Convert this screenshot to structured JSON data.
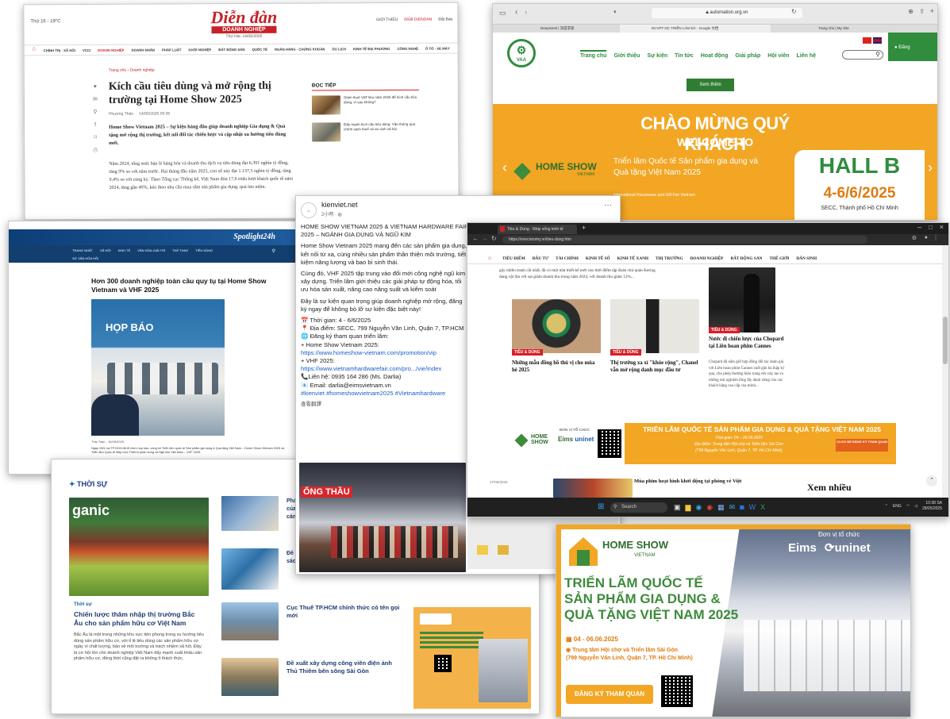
{
  "colors": {
    "accent": "#d7261e",
    "orange": "#f2a623",
    "green": "#3d8b3b",
    "blue": "#1e5ba8",
    "dark": "#1e1e1e"
  },
  "c1": {
    "date": "Thứ 16 - 19°C",
    "logo_top": "Diễn đàn",
    "logo_bottom": "DOANH NGHIỆP",
    "logo_date": "Thứ Hai, 16/05/2025",
    "top_right": [
      "GIỚI THIỆU",
      "0938 DIENDAN",
      "Đặt Báo"
    ],
    "nav": [
      "CHÍNH TRỊ - XÃ HỘI",
      "VCCI",
      "DOANH NGHIỆP",
      "DOANH NHÂN",
      "PHÁP LUẬT",
      "KHỞI NGHIỆP",
      "BẤT ĐỘNG SẢN",
      "QUỐC TẾ",
      "NGÂN HÀNG - CHỨNG KHOÁN",
      "DU LỊCH",
      "KINH TẾ ĐỊA PHƯƠNG",
      "CÔNG NGHỆ",
      "Ô TÔ - XE MÁY"
    ],
    "breadcrumb": "Trang chủ  ›  Doanh nghiệp",
    "title": "Kích cầu tiêu dùng và mở rộng thị trường tại Home Show 2025",
    "author": "Phương Thảo",
    "time": "14/05/2025 09:36",
    "lead": "Home Show Vietnam 2025 – Sự kiện hàng đầu giúp doanh nghiệp Gia dụng & Quà tặng mở rộng thị trường, kết nối đối tác chiến lược và cập nhật xu hướng tiêu dùng mới.",
    "body1": "Năm 2024, tổng mức bán lẻ hàng hóa và doanh thu dịch vụ tiêu dùng đạt 6.391 nghìn tỷ đồng, tăng 9% so với năm trước. Hai tháng đầu năm 2025, con số này đạt 1.137,5 nghìn tỷ đồng, tăng 9,4% so với cùng kỳ. Theo Tổng cục Thống kê, Việt Nam đón 17,6 triệu lượt khách quốc tế năm 2024, tăng gần 40%, kéo theo nhu cầu mua sắm sản phẩm gia dụng, quà lưu niệm.",
    "sidebar_title": "ĐỌC TIẾP",
    "sidebar_items": [
      "Giảm thuế VAT liệu năm 2025 để kích cầu tiêu dùng, vì sao không?",
      "Đẩy mạnh kích cầu tiêu dùng: Vận thông qua chính sách thuế và an sinh xã hội"
    ]
  },
  "c2": {
    "tabs": [
      "DeepSeek | 深度求索",
      "DCVPT NC TRIỂN LÃM ĐÃ - Google 文档",
      "Trang chủ | My Site"
    ],
    "url": "automation.org.vn",
    "vaa": "VAA",
    "nav": [
      "Trang chủ",
      "Giới thiệu",
      "Sự kiện",
      "Tin tức",
      "Hoạt động",
      "Giải pháp",
      "Hội viên",
      "Liên hệ"
    ],
    "more_btn": "Xem thêm",
    "welcome_vi": "CHÀO MỪNG QUÝ KHÁCH",
    "welcome_en": "WELCOME TO",
    "brand": "HOME SHOW",
    "brand_sub": "VIETNAM",
    "expo_vi": "Triển lãm Quốc tế Sản phẩm gia dụng và Quà tặng Việt Nam 2025",
    "expo_en": "International Houseware and Gift Fair Vietnam",
    "hall": "HALL B",
    "dates": "4-6/6/2025",
    "venue": "SECC, Thành phố Hồ Chí Minh",
    "login": "Đăng"
  },
  "c3": {
    "site": "Spotlight24h",
    "nav": [
      "TRANG NHẤT",
      "XÃ HỘI",
      "KINH TẾ",
      "VĂN HÓA-GIẢI TRÍ",
      "THỂ THAO",
      "TIÊU DÙNG"
    ],
    "nav2": "SỨ VĂN HÓA HỘI",
    "title": "Hơn 300 doanh nghiệp toàn cầu quy tụ tại Home Show Vietnam và VHF 2025",
    "photo_text": "HỌP BÁO",
    "author": "Thái Toàn",
    "date": "15/05/2025",
    "caption": "Ngày 15/5, tại TP.HCM đã tổ chức họp báo, công bố Triển lãm quốc tế Sản phẩm gia dụng & Quà tặng Việt Nam – Home Show Vietnam 2025 và Triển lãm Quốc tế Máy móc Thiết bị phần cứng và Ngũ kim Việt Nam – VHF 2025."
  },
  "c4": {
    "account": "kienviet.net",
    "meta": "2小時 · ",
    "para1": "HOME SHOW VIETNAM 2025 & VIETNAM HARDWARE FAIR 2025 – NGÀNH GIA DỤNG VÀ NGŨ KIM",
    "para2": "Home Show Vietnam 2025 mang đến các sản phẩm gia dụng, kết nối từ xa, cùng nhiều sản phẩm thân thiện môi trường, tiết kiệm năng lượng và bao bì sinh thái.",
    "para3": "Cùng đó, VHF 2025 tập trung vào đổi mới công nghệ ngũ kim xây dựng. Triển lãm giới thiệu các giải pháp tự động hóa, tối ưu hóa sản xuất, nâng cao năng suất và kiểm soát",
    "para4": "Đây là sự kiện quan trọng giúp doanh nghiệp mở rộng, đăng ký ngay để không bỏ lỡ sự kiện đặc biệt này!",
    "time": "📅 Thời gian: 4 - 6/6/2025",
    "place": "📍 Địa điểm: SECC, 799 Nguyễn Văn Linh, Quận 7, TP.HCM",
    "reg": "🌐 Đăng ký tham quan triển lãm:",
    "hs": "+ Home Show Vietnam 2025:",
    "link1": "https://www.homeshow-vietnam.com/promotion/vip",
    "vhf": "+ VHF 2025:",
    "link2": "https://www.vietnamhardwarefair.com/pro.../vie/index",
    "phone": "📞Liên hệ: 0935 164 286 (Ms. Darlia)",
    "email": "📧 Email: darlia@eimsvietnam.vn",
    "hashtags": "#kienviet #homeshowvietnam2025 #Vietnamhardware",
    "translate": "查看翻譯",
    "banner": "ỐNG THẦU"
  },
  "c5": {
    "section": "THỜI SỰ",
    "tag": "Thời sự",
    "main_title": "Chiến lược thâm nhập thị trường Bắc Âu cho sản phẩm hữu cơ Việt Nam",
    "main_desc": "Bắc Âu là một trong những khu vực tiên phong trong xu hướng tiêu dùng sản phẩm hữu cơ, với tỉ lệ tiêu dùng các sản phẩm hữu cơ ngày vì chất lượng, bảo vệ môi trường và trách nhiệm xã hội. Đây là cơ hội lớn cho doanh nghiệp Việt Nam đẩy mạnh xuất khẩu sản phẩm hữu cơ, đồng thời cũng đặt ra không ít thách thức.",
    "items": [
      "Phá của cán",
      "Đề sách",
      "Cục Thuế TP.HCM chính thức có tên gọi mới",
      "Đề xuất xây dựng công viên điện ảnh Thủ Thiêm bên sông Sài Gòn"
    ],
    "shelf_text": "ganic"
  },
  "c6": {
    "tab": "Tiêu & Dùng - Nhịp sống kinh tế",
    "url": "https://vneconomy.vn/tieu-dung.htm",
    "nav": [
      "TIÊU ĐIỂM",
      "ĐẦU TƯ",
      "TÀI CHÍNH",
      "KINH TẾ SỐ",
      "KINH TẾ XANH",
      "THỊ TRƯỜNG",
      "DOANH NGHIỆP",
      "BẤT ĐỘNG SẢN",
      "THẾ GIỚI",
      "DÂN SINH"
    ],
    "top_text": "gây nhiều tranh cãi nhất, đã có một nhà thiết kế mới vào thời điểm tập đoàn chủ quản Kering đang vật lộn với sụt giảm doanh thu trong năm 2024, với doanh thu giảm 12%...",
    "tag": "TIÊU & DÙNG",
    "art1": "Những mẫu đồng hồ thú vị cho mùa hè 2025",
    "art2": "Thị trường xa xỉ \"khóe rộng\", Chanel vẫn mở rộng danh mục đầu tư",
    "art3": "Nước đi chiến lược của Chopard tại Liên hoan phim Cannes",
    "art3_desc": "Chopard đã nắm giữ hợp đồng đối tác danh giá với Liên hoan phim Cannes suốt gần ba thập kỷ qua, cho phép thương hiệu trang sức này tạo ra những trải nghiệm lồng lẫy dành riêng cho các khách hàng cao cấp của mình...",
    "ad_title": "TRIỂN LÃM QUỐC TẾ SẢN PHẨM GIA DỤNG & QUÀ TẶNG VIỆT NAM 2025",
    "ad_time": "Thời gian: 04 – 06.06.2025",
    "ad_place": "Địa điểm: Trung tâm Hội chợ và Triển lãm Sài Gòn",
    "ad_addr": "(799 Nguyễn Văn Linh, Quận 7, TP. Hồ Chí Minh)",
    "ad_org": "ĐƠN VỊ TỔ CHỨC",
    "ad_btn": "CLICK ĐỂ ĐĂNG KÝ THAM QUAN",
    "bottom_date": "27/05/2025",
    "bottom_title": "Mùa phim hoạt hình khởi động tại phòng vé Việt",
    "bottom_right": "Xem nhiều",
    "search": "Search",
    "clock": "10:38 SA",
    "clock_date": "28/05/2025",
    "eng": "ENG"
  },
  "c7": {
    "org_label": "Đơn vị tổ chức",
    "eims": "Eims",
    "uninet": "uninet",
    "brand": "HOME SHOW",
    "brand_sub": "VIETNAM",
    "title1": "TRIỂN LÃM QUỐC TẾ",
    "title2": "SẢN PHẨM GIA DỤNG &",
    "title3": "QUÀ TẶNG VIỆT NAM 2025",
    "date": "04 - 06.06.2025",
    "venue": "Trung tâm Hội chợ và Triển lãm Sài Gòn",
    "addr": "(799 Nguyễn Văn Linh, Quận 7, TP. Hồ Chí Minh)",
    "btn": "ĐĂNG KÝ THAM QUAN"
  }
}
